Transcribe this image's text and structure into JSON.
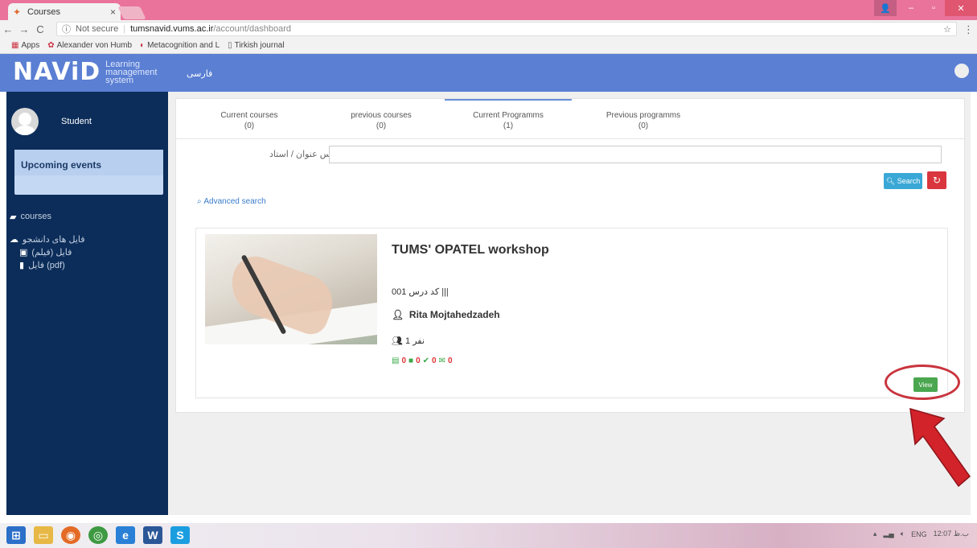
{
  "browser": {
    "tab_title": "Courses",
    "url_security": "Not secure",
    "url_host": "tumsnavid.vums.ac.ir",
    "url_path": "/account/dashboard",
    "bookmarks": [
      "Apps",
      "Alexander von Humb",
      "Metacognition and L",
      "Tirkish journal"
    ]
  },
  "header": {
    "logo_text": "NAViD",
    "logo_sub1": "Learning",
    "logo_sub2": "management",
    "logo_sub3": "system",
    "lang_link": "فارسی"
  },
  "sidebar": {
    "username": "Student",
    "events_title": "Upcoming events",
    "nav_courses": "courses",
    "nav_student_files": "فایل های دانشجو",
    "nav_video": "(فایل (فیلم",
    "nav_pdf": "فایل (pdf)"
  },
  "tabs": [
    {
      "label": "Current courses",
      "count": "(0)"
    },
    {
      "label": "previous courses",
      "count": "(0)"
    },
    {
      "label": "Current Programms",
      "count": "(1)"
    },
    {
      "label": "Previous programms",
      "count": "(0)"
    }
  ],
  "filter": {
    "label": "بر اساس عنوان / استاد",
    "search_label": "Search",
    "advanced_label": "Advanced search"
  },
  "course": {
    "title": "TUMS' OPATEL workshop",
    "code": "کد درس 001",
    "teacher": "Rita Mojtahedzadeh",
    "count": "1 نفر",
    "stats": [
      "0",
      "0",
      "0",
      "0"
    ],
    "view_label": "View"
  },
  "taskbar": {
    "lang": "ENG",
    "time": "12:07 ب.ظ"
  },
  "colors": {
    "header": "#5a7fd3",
    "sidebar": "#0c2d5a",
    "view_button": "#4aa64f",
    "annotation": "#c9343d"
  }
}
